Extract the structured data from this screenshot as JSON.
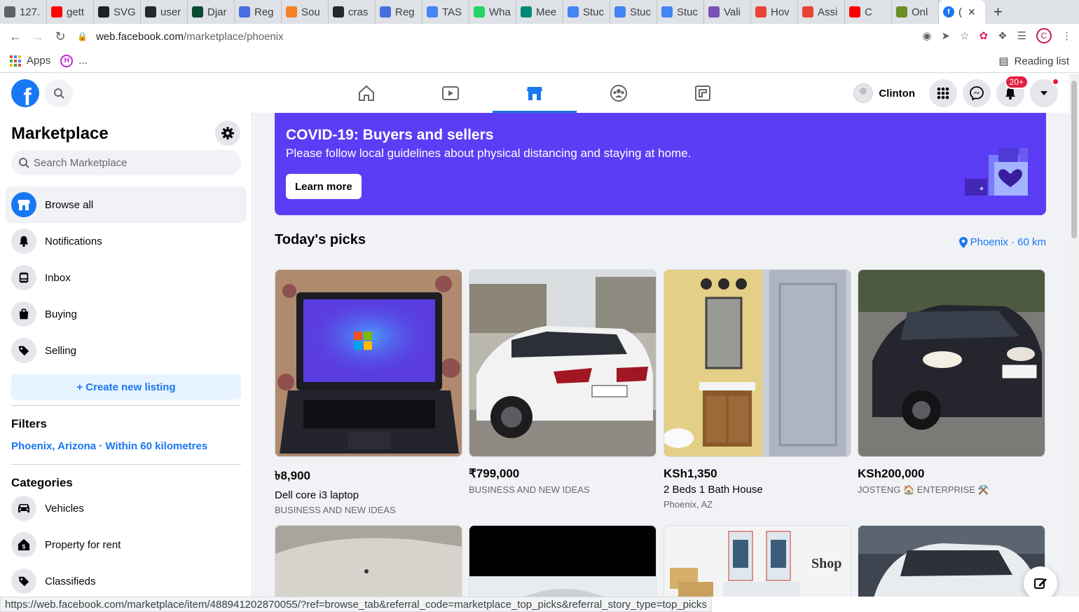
{
  "browser": {
    "tabs": [
      {
        "label": "127.",
        "color": "#5f6368"
      },
      {
        "label": "gett",
        "color": "#ff0000"
      },
      {
        "label": "SVG",
        "color": "#202124"
      },
      {
        "label": "user",
        "color": "#24292f"
      },
      {
        "label": "Djar",
        "color": "#0c4b33"
      },
      {
        "label": "Reg",
        "color": "#4a6ee0"
      },
      {
        "label": "Sou",
        "color": "#f48024"
      },
      {
        "label": "cras",
        "color": "#24292f"
      },
      {
        "label": "Reg",
        "color": "#4a6ee0"
      },
      {
        "label": "TAS",
        "color": "#4285f4"
      },
      {
        "label": "Wha",
        "color": "#25d366"
      },
      {
        "label": "Mee",
        "color": "#00897b"
      },
      {
        "label": "Stuc",
        "color": "#4285f4"
      },
      {
        "label": "Stuc",
        "color": "#4285f4"
      },
      {
        "label": "Stuc",
        "color": "#4285f4"
      },
      {
        "label": "Vali",
        "color": "#7952b3"
      },
      {
        "label": "Hov",
        "color": "#ea4335"
      },
      {
        "label": "Assi",
        "color": "#ea4335"
      },
      {
        "label": "C",
        "color": "#ff0000"
      },
      {
        "label": "Onl",
        "color": "#6b8e23"
      }
    ],
    "active_tab": {
      "label": "(",
      "close": "✕"
    },
    "new_tab": "+",
    "url_host": "web.facebook.com",
    "url_path": "/marketplace/phoenix",
    "profile_letter": "C",
    "bookmarks": {
      "apps": "Apps",
      "more": "...",
      "reading_list": "Reading list"
    },
    "status_url": "https://web.facebook.com/marketplace/item/488941202870055/?ref=browse_tab&referral_code=marketplace_top_picks&referral_story_type=top_picks"
  },
  "header": {
    "logo": "f",
    "user_name": "Clinton",
    "notif_badge": "20+"
  },
  "sidebar": {
    "title": "Marketplace",
    "search_placeholder": "Search Marketplace",
    "items": [
      {
        "label": "Browse all"
      },
      {
        "label": "Notifications"
      },
      {
        "label": "Inbox"
      },
      {
        "label": "Buying"
      },
      {
        "label": "Selling"
      }
    ],
    "create_listing": "+ Create new listing",
    "filters_title": "Filters",
    "filter_location": "Phoenix, Arizona · Within 60 kilometres",
    "categories_title": "Categories",
    "categories": [
      {
        "label": "Vehicles"
      },
      {
        "label": "Property for rent"
      },
      {
        "label": "Classifieds"
      }
    ]
  },
  "banner": {
    "title": "COVID-19: Buyers and sellers",
    "text": "Please follow local guidelines about physical distancing and staying at home.",
    "button": "Learn more"
  },
  "picks": {
    "title": "Today's picks",
    "location": "Phoenix · 60 km",
    "items": [
      {
        "price": "৳8,900",
        "title": "Dell core i3 laptop",
        "seller": "BUSINESS AND NEW IDEAS"
      },
      {
        "price": "₹799,000",
        "title": "",
        "seller": "BUSINESS AND NEW IDEAS"
      },
      {
        "price": "KSh1,350",
        "title": "2 Beds 1 Bath House",
        "seller": "Phoenix, AZ"
      },
      {
        "price": "KSh200,000",
        "title": "",
        "seller": "JOSTENG 🏠 ENTERPRISE ⚒️"
      }
    ]
  },
  "colors": {
    "facebook_blue": "#1877f2",
    "banner_purple": "#5b3df5"
  }
}
